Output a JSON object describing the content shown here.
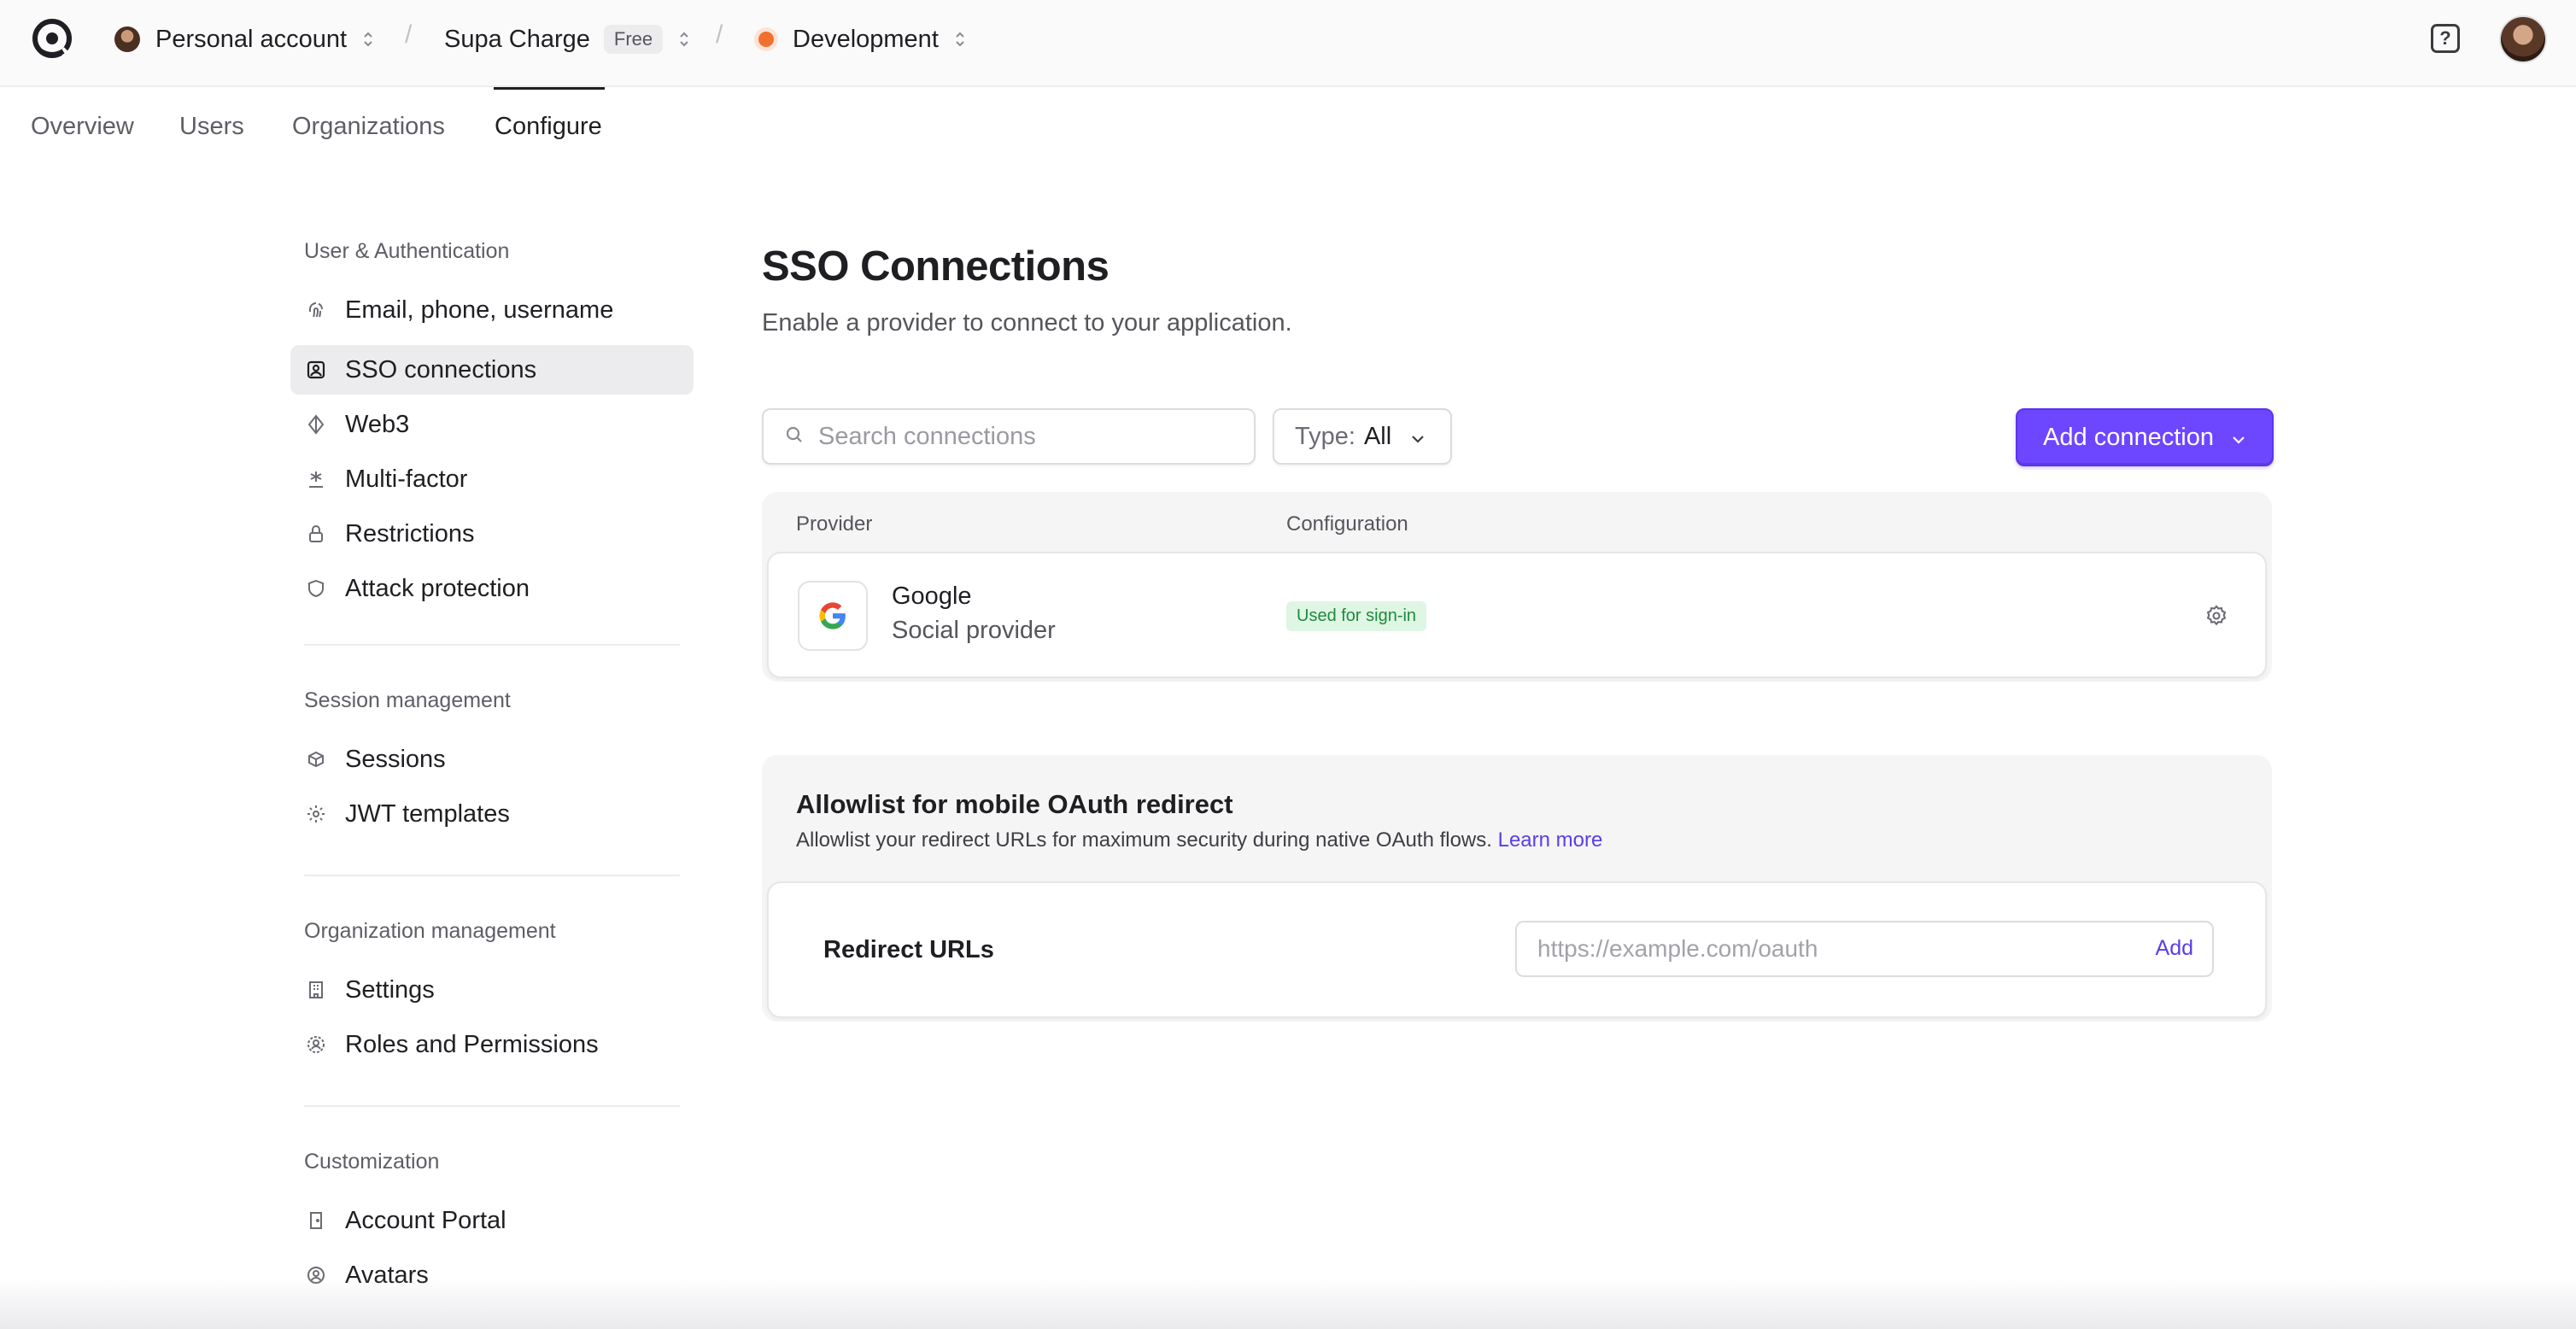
{
  "topbar": {
    "account": "Personal account",
    "app": "Supa Charge",
    "plan_badge": "Free",
    "environment": "Development",
    "separator": "/",
    "help_glyph": "?"
  },
  "tabs": [
    {
      "label": "Overview"
    },
    {
      "label": "Users"
    },
    {
      "label": "Organizations"
    },
    {
      "label": "Configure"
    }
  ],
  "sidebar": {
    "groups": [
      {
        "title": "User & Authentication",
        "items": [
          {
            "label": "Email, phone, username",
            "icon": "fingerprint-icon"
          },
          {
            "label": "SSO connections",
            "icon": "sso-icon"
          },
          {
            "label": "Web3",
            "icon": "web3-icon"
          },
          {
            "label": "Multi-factor",
            "icon": "asterisk-icon"
          },
          {
            "label": "Restrictions",
            "icon": "lock-icon"
          },
          {
            "label": "Attack protection",
            "icon": "shield-icon"
          }
        ]
      },
      {
        "title": "Session management",
        "items": [
          {
            "label": "Sessions",
            "icon": "sessions-icon"
          },
          {
            "label": "JWT templates",
            "icon": "gear-icon"
          }
        ]
      },
      {
        "title": "Organization management",
        "items": [
          {
            "label": "Settings",
            "icon": "building-icon"
          },
          {
            "label": "Roles and Permissions",
            "icon": "roles-icon"
          }
        ]
      },
      {
        "title": "Customization",
        "items": [
          {
            "label": "Account Portal",
            "icon": "door-icon"
          },
          {
            "label": "Avatars",
            "icon": "avatar-icon"
          }
        ]
      }
    ]
  },
  "main": {
    "title": "SSO Connections",
    "subtitle": "Enable a provider to connect to your application.",
    "search_placeholder": "Search connections",
    "type_label": "Type:",
    "type_value": "All",
    "add_button": "Add connection",
    "table": {
      "col_provider": "Provider",
      "col_configuration": "Configuration",
      "rows": [
        {
          "name": "Google",
          "type": "Social provider",
          "status": "Used for sign-in"
        }
      ]
    },
    "allowlist": {
      "title": "Allowlist for mobile OAuth redirect",
      "description": "Allowlist your redirect URLs for maximum security during native OAuth flows.",
      "learn_more": "Learn more",
      "field_label": "Redirect URLs",
      "field_placeholder": "https://example.com/oauth",
      "add_label": "Add"
    }
  },
  "colors": {
    "accent": "#6c47ff",
    "link": "#5b3de8",
    "status_green": "#1f8a3c",
    "env_dot": "#f2702f"
  }
}
